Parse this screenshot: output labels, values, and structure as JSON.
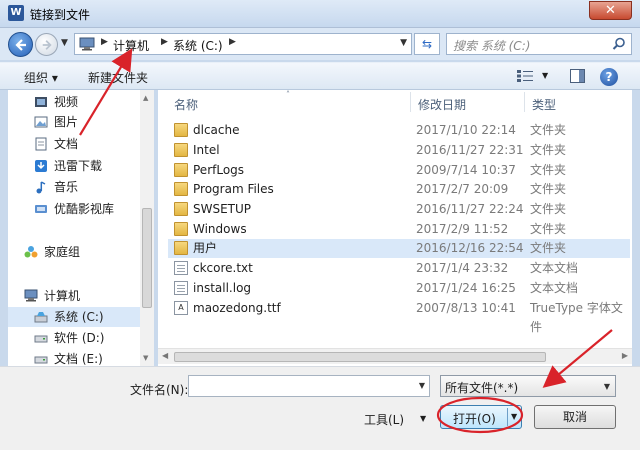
{
  "window": {
    "title": "链接到文件",
    "app_icon": "W",
    "close_label": "✕"
  },
  "address": {
    "crumbs": [
      "计算机",
      "系统 (C:)"
    ],
    "search_placeholder": "搜索 系统 (C:)"
  },
  "toolbar": {
    "organize_label": "组织 ▾",
    "new_folder_label": "新建文件夹"
  },
  "nav": {
    "items": [
      {
        "label": "视频",
        "icon": "video-icon"
      },
      {
        "label": "图片",
        "icon": "picture-icon"
      },
      {
        "label": "文档",
        "icon": "document-icon"
      },
      {
        "label": "迅雷下载",
        "icon": "download-icon"
      },
      {
        "label": "音乐",
        "icon": "music-icon"
      },
      {
        "label": "优酷影视库",
        "icon": "video-library-icon"
      },
      {
        "label": "家庭组",
        "icon": "homegroup-icon"
      },
      {
        "label": "计算机",
        "icon": "computer-icon"
      },
      {
        "label": "系统 (C:)",
        "icon": "drive-icon",
        "selected": true
      },
      {
        "label": "软件 (D:)",
        "icon": "drive-icon"
      },
      {
        "label": "文档 (E:)",
        "icon": "drive-icon"
      }
    ]
  },
  "files": {
    "columns": [
      "名称",
      "修改日期",
      "类型"
    ],
    "rows": [
      {
        "name": "dlcache",
        "date": "2017/1/10 22:14",
        "type": "文件夹",
        "kind": "folder"
      },
      {
        "name": "Intel",
        "date": "2016/11/27 22:31",
        "type": "文件夹",
        "kind": "folder"
      },
      {
        "name": "PerfLogs",
        "date": "2009/7/14 10:37",
        "type": "文件夹",
        "kind": "folder"
      },
      {
        "name": "Program Files",
        "date": "2017/2/7 20:09",
        "type": "文件夹",
        "kind": "folder"
      },
      {
        "name": "SWSETUP",
        "date": "2016/11/27 22:24",
        "type": "文件夹",
        "kind": "folder"
      },
      {
        "name": "Windows",
        "date": "2017/2/9 11:52",
        "type": "文件夹",
        "kind": "folder"
      },
      {
        "name": "用户",
        "date": "2016/12/16 22:54",
        "type": "文件夹",
        "kind": "folder",
        "selected": true
      },
      {
        "name": "ckcore.txt",
        "date": "2017/1/4 23:32",
        "type": "文本文档",
        "kind": "text"
      },
      {
        "name": "install.log",
        "date": "2017/1/24 16:25",
        "type": "文本文档",
        "kind": "text"
      },
      {
        "name": "maozedong.ttf",
        "date": "2007/8/13 10:41",
        "type": "TrueType 字体文件",
        "kind": "font"
      }
    ]
  },
  "bottom": {
    "filename_label": "文件名(N):",
    "filename_value": "",
    "filetype_value": "所有文件(*.*)",
    "tools_label": "工具(L)",
    "open_label": "打开(O)",
    "cancel_label": "取消"
  },
  "colors": {
    "annotation_red": "#d9232a",
    "selection_blue": "#d9e8f9"
  }
}
